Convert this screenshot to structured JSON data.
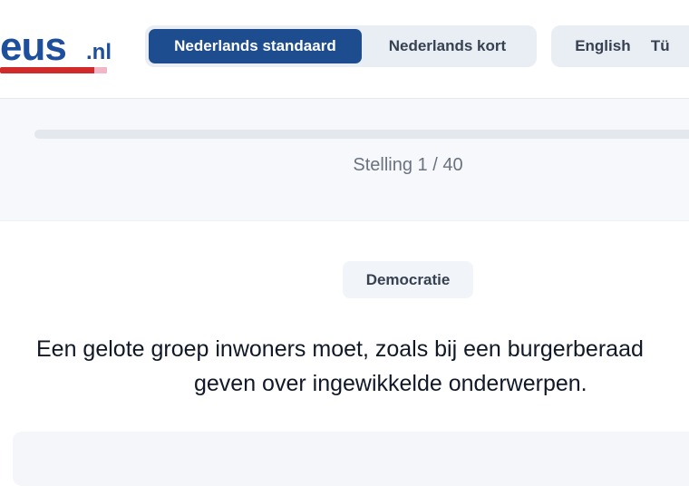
{
  "header": {
    "logo": {
      "main": "eus",
      "suffix": ".nl"
    },
    "language_options": [
      {
        "label": "Nederlands standaard",
        "active": true
      },
      {
        "label": "Nederlands kort",
        "active": false
      }
    ],
    "other_languages": [
      {
        "label": "English"
      },
      {
        "label": "Tü"
      }
    ]
  },
  "progress": {
    "label": "Stelling 1 / 40",
    "current": 1,
    "total": 40,
    "fraction": 0.0
  },
  "statement": {
    "category": "Democratie",
    "line1": "Een gelote groep inwoners moet, zoals bij een burgerberaad",
    "line2": "geven over ingewikkelde onderwerpen."
  },
  "colors": {
    "brand": "#1e4f9c",
    "active_tab": "#1e4d8f",
    "accent_red": "#d12a2a"
  }
}
